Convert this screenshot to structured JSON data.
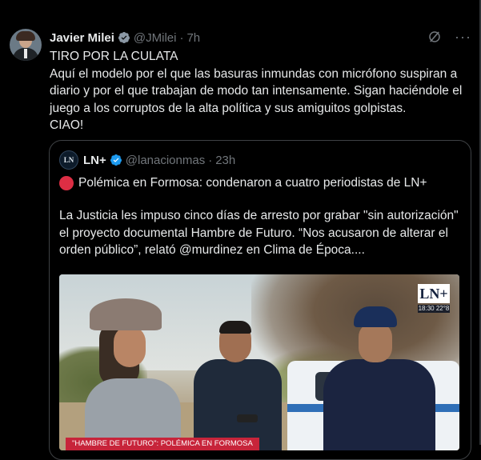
{
  "tweet": {
    "author_name": "Javier Milei",
    "handle": "@JMilei",
    "separator": "·",
    "time": "7h",
    "more": "···",
    "lines": [
      "TIRO POR LA CULATA",
      "Aquí el modelo por el que las basuras inmundas con micrófono suspiran a diario y por el que trabajan de modo tan intensamente. Sigan haciéndole el juego a los corruptos de la alta política y sus amiguitos golpistas.",
      "CIAO!"
    ]
  },
  "quote": {
    "avatar_text": "LN",
    "author_name": "LN+",
    "handle": "@lanacionmas",
    "separator": "·",
    "time": "23h",
    "title": "Polémica en Formosa: condenaron a cuatro periodistas de LN+",
    "body": "La Justicia les impuso cinco días de arresto por grabar \"sin autorización\" el proyecto documental Hambre de Futuro. “Nos acusaron de alterar el orden público”, relató @murdinez en Clima de Época....",
    "media": {
      "logo": "LN+",
      "logo_time": "18:30  22°8",
      "caption": "\"HAMBRE DE FUTURO\": POLÉMICA EN FORMOSA"
    }
  },
  "colors": {
    "background": "#000000",
    "text": "#e7e9ea",
    "muted": "#71767b",
    "verified": "#1d9bf0",
    "border": "#3e4144"
  }
}
